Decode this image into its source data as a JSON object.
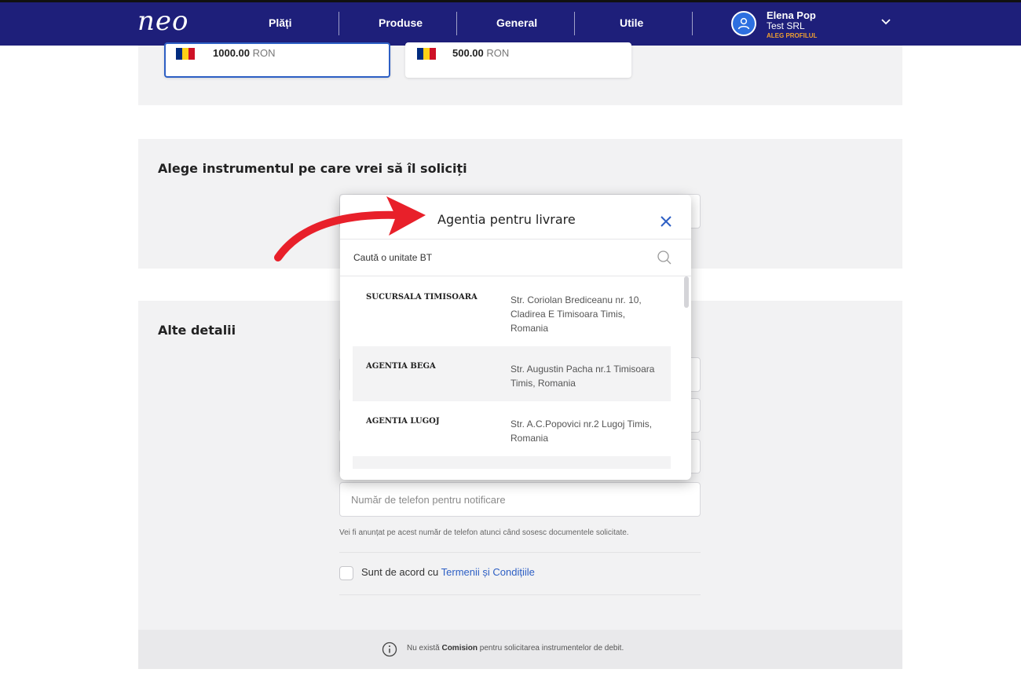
{
  "header": {
    "logo": "neo",
    "nav": [
      "Plăți",
      "Produse",
      "General",
      "Utile"
    ],
    "user": {
      "name": "Elena Pop",
      "company": "Test SRL",
      "profile_link": "ALEG PROFILUL"
    }
  },
  "amounts": [
    {
      "value": "1000.00",
      "currency": "RON",
      "selected": true
    },
    {
      "value": "500.00",
      "currency": "RON",
      "selected": false
    }
  ],
  "flag_colors": [
    "#002b7f",
    "#fcd116",
    "#ce1126"
  ],
  "section_instrument": {
    "title": "Alege instrumentul pe care vrei să îl soliciți"
  },
  "section_details": {
    "title": "Alte detalii",
    "phone_placeholder": "Număr de telefon pentru notificare",
    "phone_hint": "Vei fi anunțat pe acest număr de telefon atunci când sosesc documentele solicitate.",
    "terms_text": "Sunt de acord cu ",
    "terms_link": "Termenii și Condițiile"
  },
  "info_bar": {
    "prefix": "Nu există ",
    "bold": "Comision",
    "suffix": " pentru solicitarea instrumentelor de debit."
  },
  "modal": {
    "title": "Agentia pentru livrare",
    "search_placeholder": "Caută o unitate BT",
    "items": [
      {
        "name": "SUCURSALA TIMISOARA",
        "address": "Str. Coriolan Brediceanu nr. 10, Cladirea E Timisoara Timis, Romania"
      },
      {
        "name": "AGENTIA BEGA",
        "address": "Str. Augustin Pacha nr.1 Timisoara Timis, Romania"
      },
      {
        "name": "AGENTIA LUGOJ",
        "address": "Str. A.C.Popovici nr.2 Lugoj Timis, Romania"
      }
    ]
  },
  "colors": {
    "navbar": "#1e1f7a",
    "accent": "#2d5fc4",
    "arrow": "#e8202a",
    "profile_link": "#f0a030"
  },
  "icons": [
    "search-icon",
    "close-icon",
    "chevron-down-icon",
    "user-icon",
    "info-icon",
    "arrow-annotation"
  ]
}
